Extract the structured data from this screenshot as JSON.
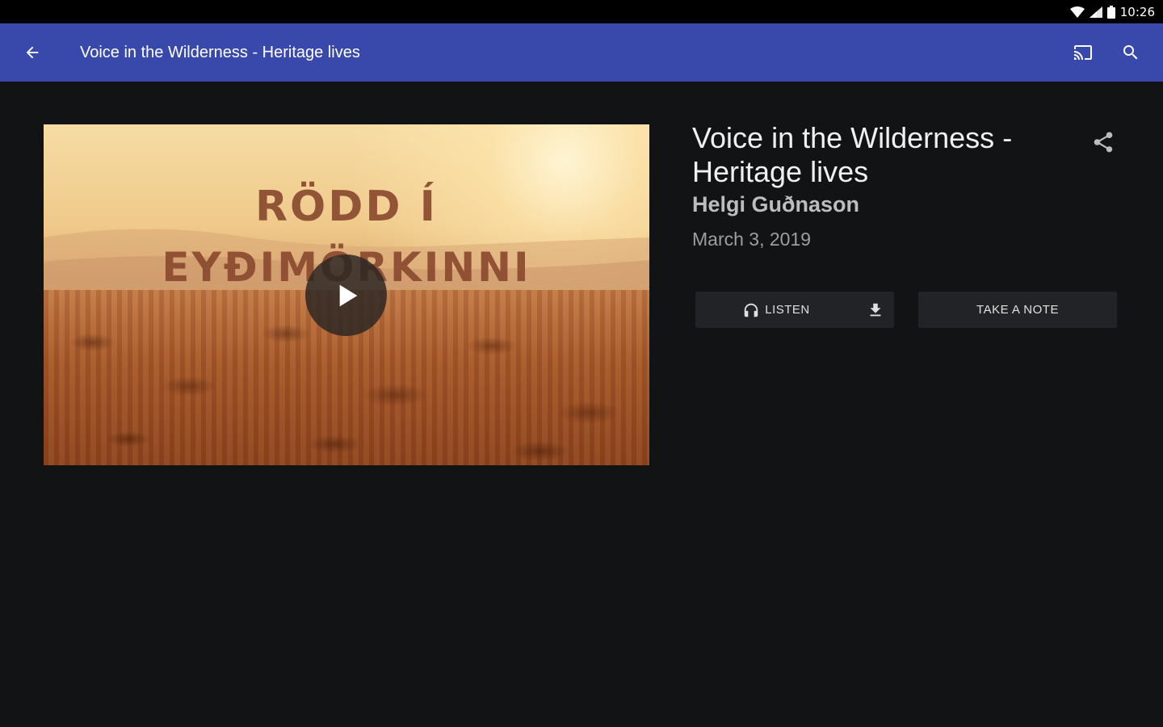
{
  "status_bar": {
    "time": "10:26"
  },
  "app_bar": {
    "title": "Voice in the Wilderness - Heritage lives",
    "back_icon": "arrow-back-icon",
    "cast_icon": "cast-icon",
    "search_icon": "search-icon",
    "color": "#3949ab"
  },
  "thumbnail": {
    "line1": "RÖDD Í",
    "line2": "EYÐIMÖRKINNI",
    "play_icon": "play-icon"
  },
  "media": {
    "title": "Voice in the Wilderness - Heritage lives",
    "speaker": "Helgi Guðnason",
    "date": "March 3, 2019",
    "share_icon": "share-icon"
  },
  "actions": {
    "listen_label": "LISTEN",
    "listen_icon": "headphones-icon",
    "download_icon": "download-icon",
    "note_label": "TAKE A NOTE"
  }
}
